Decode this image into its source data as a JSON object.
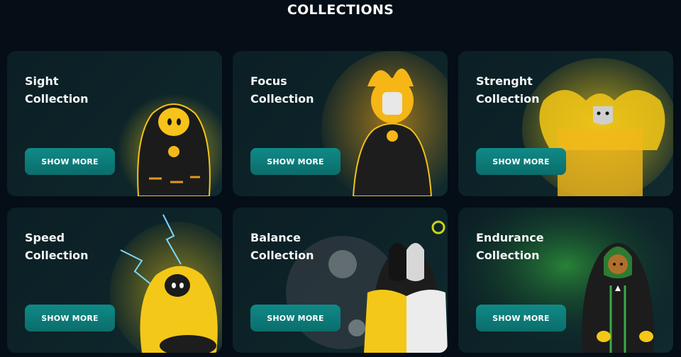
{
  "page": {
    "heading": "COLLECTIONS"
  },
  "collections": [
    {
      "title": "Sight\nCollection",
      "button": "SHOW MORE",
      "art_icon": "sight-mascot"
    },
    {
      "title": "Focus\nCollection",
      "button": "SHOW MORE",
      "art_icon": "focus-mascot"
    },
    {
      "title": "Strenght\nCollection",
      "button": "SHOW MORE",
      "art_icon": "strength-mascot"
    },
    {
      "title": "Speed\nCollection",
      "button": "SHOW MORE",
      "art_icon": "speed-mascot"
    },
    {
      "title": "Balance\nCollection",
      "button": "SHOW MORE",
      "art_icon": "balance-mascot"
    },
    {
      "title": "Endurance\nCollection",
      "button": "SHOW MORE",
      "art_icon": "endurance-mascot"
    }
  ],
  "colors": {
    "background": "#050d16",
    "card": "#0d2429",
    "button": "#0f8a87",
    "accent": "#f2c21b"
  }
}
